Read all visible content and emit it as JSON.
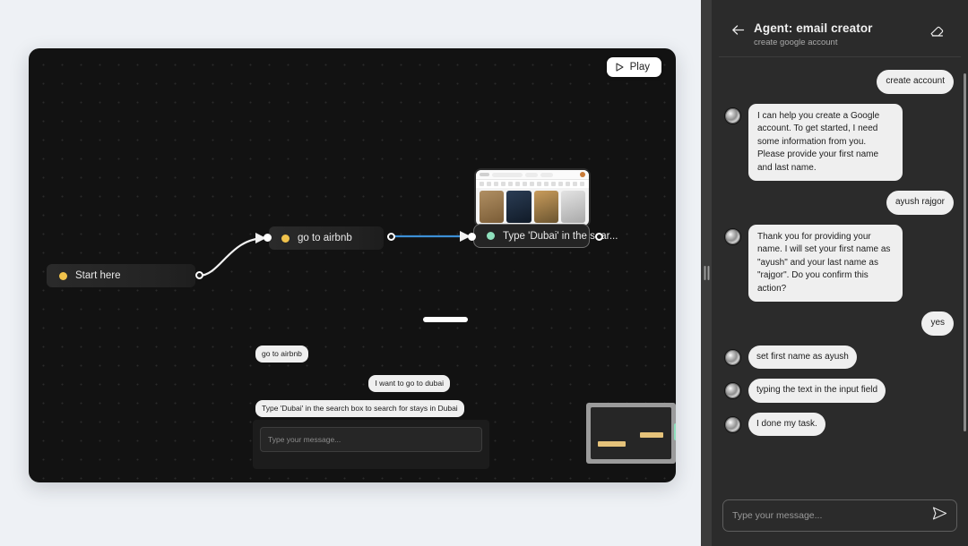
{
  "workspace": {
    "play_button_label": "Play",
    "nodes": [
      {
        "id": "start",
        "label": "Start here",
        "dot_color": "#f0c24b"
      },
      {
        "id": "airbnb",
        "label": "go to airbnb",
        "dot_color": "#f0c24b"
      },
      {
        "id": "type-dubai",
        "label": "Type 'Dubai' in the sear...",
        "dot_color": "#8fe0bd"
      }
    ],
    "canvas_chat": {
      "messages": [
        {
          "id": "m1",
          "side": "agent",
          "text": "go to airbnb"
        },
        {
          "id": "m2",
          "side": "user",
          "text": "I want to go to dubai"
        },
        {
          "id": "m3",
          "side": "agent",
          "text": "Type 'Dubai' in the search box to search for stays in Dubai"
        }
      ],
      "input_placeholder": "Type your message..."
    },
    "preview_card": {
      "tile_colors": [
        "#8a6a44",
        "#1d2a3c",
        "#b08a4e",
        "#d9d9d9"
      ]
    },
    "mini_widget": {
      "accent_bar_color": "#e5c27a",
      "accent_block_color": "#8fe0bd"
    }
  },
  "chat": {
    "title": "Agent: email creator",
    "subtitle": "create google account",
    "back_icon": "arrow-left-icon",
    "clear_icon": "eraser-icon",
    "messages": [
      {
        "id": "c1",
        "side": "user",
        "text": "create account"
      },
      {
        "id": "c2",
        "side": "agent",
        "text": "I can help you create a Google account. To get started, I need some information from you. Please provide your first name and last name."
      },
      {
        "id": "c3",
        "side": "user",
        "text": "ayush rajgor"
      },
      {
        "id": "c4",
        "side": "agent",
        "text": "Thank you for providing your name. I will set your first name as \"ayush\" and your last name as \"rajgor\". Do you confirm this action?"
      },
      {
        "id": "c5",
        "side": "user",
        "text": "yes"
      },
      {
        "id": "c6",
        "side": "agent",
        "text": "set first name as ayush"
      },
      {
        "id": "c7",
        "side": "agent",
        "text": "typing the text in the input field"
      },
      {
        "id": "c8",
        "side": "agent",
        "text": "I done my task."
      }
    ],
    "composer": {
      "placeholder": "Type your message...",
      "send_icon": "send-icon"
    }
  },
  "colors": {
    "page_bg": "#eef1f5",
    "canvas_bg": "#121212",
    "panel_bg": "#2b2b2b",
    "bubble_bg": "#efefef",
    "edge_active": "#3c8fd6",
    "node_dot_start": "#f0c24b",
    "node_dot_active": "#8fe0bd"
  }
}
